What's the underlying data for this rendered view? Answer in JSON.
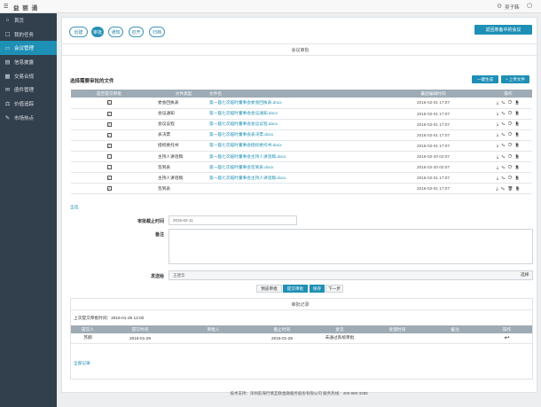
{
  "topbar": {
    "menu_icon": "☰",
    "logo": "益 丽 通",
    "user": "吴子韩",
    "gear_icon": "⚙",
    "power_icon": "⏻"
  },
  "sidebar": {
    "items": [
      {
        "label": "首页",
        "icon": "⌂"
      },
      {
        "label": "我的任务",
        "icon": "☐"
      },
      {
        "label": "会议管理",
        "icon": "▭"
      },
      {
        "label": "信息披露",
        "icon": "▤"
      },
      {
        "label": "交易合规",
        "icon": "▦"
      },
      {
        "label": "函件管理",
        "icon": "✉"
      },
      {
        "label": "价值追踪",
        "icon": "⚖"
      },
      {
        "label": "市场热点",
        "icon": "✎"
      }
    ]
  },
  "tabs": [
    {
      "label": "创建"
    },
    {
      "label": "审批"
    },
    {
      "label": "通知"
    },
    {
      "label": "召开"
    },
    {
      "label": "归档"
    }
  ],
  "back_button": "返回筹备中的会议",
  "section_title": "会议审批",
  "select_label": "选择需要审批的文件",
  "generate_button": "一键生成",
  "upload_button": "+ 上传文件",
  "doc_table": {
    "headers": [
      "是否提交审批",
      "文件类型",
      "文件名",
      "最后编辑时间",
      "操作"
    ],
    "rows": [
      {
        "checked": true,
        "type": "委会回执表",
        "name": "第一届七次临时董事会委会回执表.docx",
        "time": "2016-02-01 17:07",
        "actions": "⤓ ✎ ⟳ 🗎"
      },
      {
        "checked": true,
        "type": "会议通知",
        "name": "第一届七次临时董事会会议通知.docx",
        "time": "2016-02-01 17:07",
        "actions": "⤓ ✎ ⟳ 🗎"
      },
      {
        "checked": true,
        "type": "会议议程",
        "name": "第一届七次临时董事会会议议程.docx",
        "time": "2016-02-01 17:07",
        "actions": "⤓ ✎ ⟳ 🗎"
      },
      {
        "checked": true,
        "type": "表决票",
        "name": "第一届七次临时董事会表决票.docx",
        "time": "2016-02-01 17:07",
        "actions": "⤓ ✎ ⟳ 🗎"
      },
      {
        "checked": true,
        "type": "授权委托书",
        "name": "第一届七次临时董事会授权委托书.docx",
        "time": "2016-02-01 17:07",
        "actions": "⤓ ✎ ⟳ 🗎"
      },
      {
        "checked": false,
        "type": "主持人讲话稿",
        "name": "第一届七次临时董事会主持人讲话稿.docx",
        "time": "2016-02-20 02:07",
        "actions": "⤓ ✎ ⟳ 🗎"
      },
      {
        "checked": false,
        "type": "签到表",
        "name": "第一届七次临时董事会签到表.docx",
        "time": "2016-02-20 02:07",
        "actions": "⤓ ✎ ⟳ 🗎"
      },
      {
        "checked": true,
        "type": "主持人讲话稿",
        "name": "第一届七次临时董事会主持人讲话稿.docx",
        "time": "2016-02-01 17:07",
        "actions": "⤓ ✎ ⟳ 🗎"
      },
      {
        "checked": true,
        "type": "签到表",
        "name": "",
        "time": "2016-02-01 17:07",
        "actions": "⤓ ✎ 🗑 🗎"
      }
    ]
  },
  "select_all": "全选",
  "form": {
    "deadline_label": "审批截止时间",
    "deadline_value": "2016-02-11",
    "remark_label": "备注",
    "remark_value": "",
    "send_to_label": "发送给",
    "send_to_value": "王建华",
    "select_link": "选择"
  },
  "actions": {
    "review": "预览审批",
    "submit": "提交审批",
    "save": "保存",
    "next": "下一步"
  },
  "record": {
    "title": "审批记录",
    "last_submit": "上次提交审批时间：2016-01-29 12:00",
    "headers": [
      "提交人",
      "提交时间",
      "审批人",
      "截止时间",
      "意见",
      "处理时间",
      "备注",
      "操作"
    ],
    "rows": [
      {
        "submitter": "苏翔",
        "submit_time": "2016-01-29",
        "approver": "",
        "deadline": "2016-01-29",
        "opinion": "未通过系统审批",
        "handle_time": "",
        "remark": "",
        "action": "↩"
      }
    ],
    "all_records": "全部记录"
  },
  "footer": "技术支持：深圳前海行情互联金融服务股份有限公司    服务热线：400-880-3388"
}
